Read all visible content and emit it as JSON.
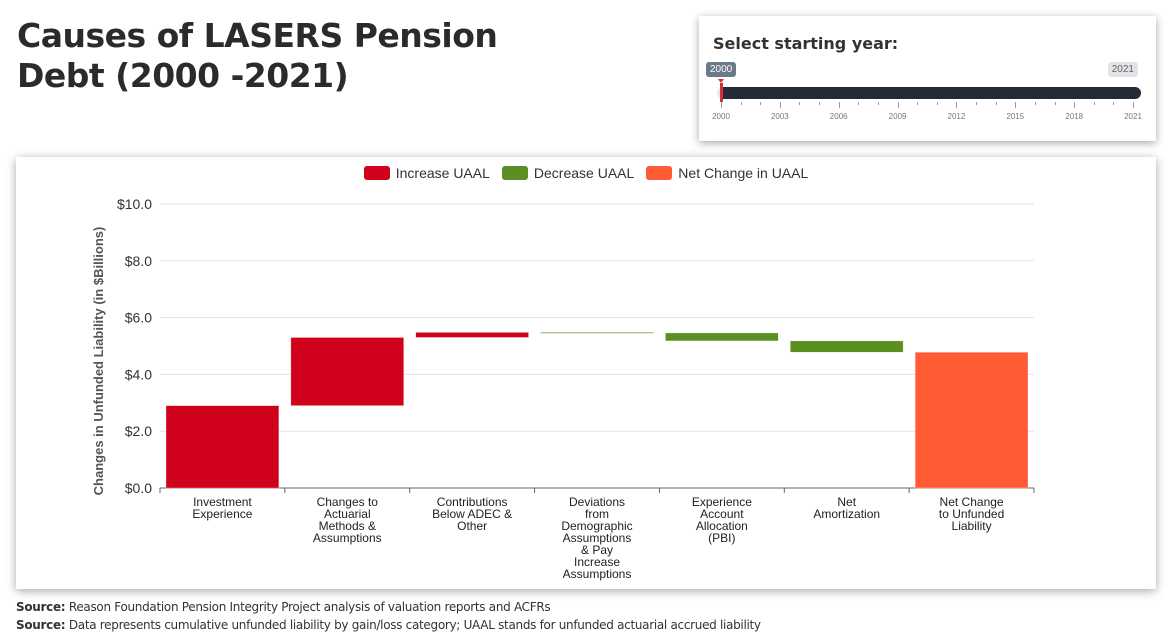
{
  "page": {
    "title_line1": "Causes of LASERS Pension",
    "title_line2": "Debt (2000 -2021)"
  },
  "slider": {
    "label": "Select starting year:",
    "selected_from": "2000",
    "selected_to": "2021",
    "min": 2000,
    "max": 2021,
    "tick_labels": [
      "2000",
      "2003",
      "2006",
      "2009",
      "2012",
      "2015",
      "2018",
      "2021"
    ],
    "accent_color": "#d6303a",
    "fill_color": "#232b36"
  },
  "colors": {
    "increase": "#d0021b",
    "decrease": "#5b8f22",
    "net": "#ff5c35"
  },
  "chart_data": {
    "type": "bar",
    "subtype": "waterfall",
    "title": "",
    "xlabel": "",
    "ylabel": "Changes in Unfunded Liability (in $Billions)",
    "ylim": [
      0,
      10
    ],
    "yticks": [
      0,
      2,
      4,
      6,
      8,
      10
    ],
    "ytick_labels": [
      "$0.0",
      "$2.0",
      "$4.0",
      "$6.0",
      "$8.0",
      "$10.0"
    ],
    "grid": true,
    "legend_position": "top-center",
    "legend": [
      {
        "name": "Increase UAAL",
        "color": "#d0021b"
      },
      {
        "name": "Decrease UAAL",
        "color": "#5b8f22"
      },
      {
        "name": "Net Change in UAAL",
        "color": "#ff5c35"
      }
    ],
    "categories": [
      [
        "Investment",
        "Experience"
      ],
      [
        "Changes to",
        "Actuarial",
        "Methods &",
        "Assumptions"
      ],
      [
        "Contributions",
        "Below ADEC &",
        "Other"
      ],
      [
        "Deviations",
        "from",
        "Demographic",
        "Assumptions",
        "& Pay",
        "Increase",
        "Assumptions"
      ],
      [
        "Experience",
        "Account",
        "Allocation",
        "(PBI)"
      ],
      [
        "Net",
        "Amortization"
      ],
      [
        "Net Change",
        "to Unfunded",
        "Liability"
      ]
    ],
    "bars": [
      {
        "category": "Investment Experience",
        "type": "increase",
        "start": 0.0,
        "end": 2.9,
        "value": 2.9
      },
      {
        "category": "Changes to Actuarial Methods & Assumptions",
        "type": "increase",
        "start": 2.9,
        "end": 5.3,
        "value": 2.4
      },
      {
        "category": "Contributions Below ADEC & Other",
        "type": "increase",
        "start": 5.3,
        "end": 5.48,
        "value": 0.18
      },
      {
        "category": "Deviations from Demographic Assumptions & Pay Increase Assumptions",
        "type": "decrease",
        "start": 5.48,
        "end": 5.46,
        "value": -0.02
      },
      {
        "category": "Experience Account Allocation (PBI)",
        "type": "decrease",
        "start": 5.46,
        "end": 5.18,
        "value": -0.28
      },
      {
        "category": "Net Amortization",
        "type": "decrease",
        "start": 5.18,
        "end": 4.78,
        "value": -0.4
      },
      {
        "category": "Net Change to Unfunded Liability",
        "type": "net",
        "start": 0.0,
        "end": 4.78,
        "value": 4.78
      }
    ]
  },
  "footer": {
    "sources": [
      {
        "label": "Source:",
        "text": " Reason Foundation Pension Integrity Project analysis of valuation reports and ACFRs"
      },
      {
        "label": "Source:",
        "text": " Data represents cumulative unfunded liability by gain/loss category; UAAL stands for unfunded actuarial accrued liability"
      }
    ]
  }
}
